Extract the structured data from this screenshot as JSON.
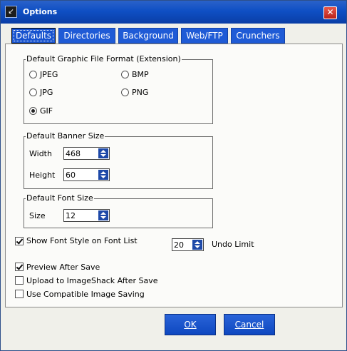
{
  "window": {
    "title": "Options",
    "app_icon_glyph": "↙",
    "close_glyph": "✕"
  },
  "tabs": [
    {
      "label": "Defaults",
      "active": true
    },
    {
      "label": "Directories",
      "active": false
    },
    {
      "label": "Background",
      "active": false
    },
    {
      "label": "Web/FTP",
      "active": false
    },
    {
      "label": "Crunchers",
      "active": false
    }
  ],
  "graphic_format": {
    "title": "Default Graphic File Format (Extension)",
    "options": [
      {
        "label": "JPEG",
        "checked": false
      },
      {
        "label": "BMP",
        "checked": false
      },
      {
        "label": "JPG",
        "checked": false
      },
      {
        "label": "PNG",
        "checked": false
      },
      {
        "label": "GIF",
        "checked": true
      }
    ]
  },
  "banner_size": {
    "title": "Default Banner Size",
    "width_label": "Width",
    "width_value": "468",
    "height_label": "Height",
    "height_value": "60"
  },
  "font_size": {
    "title": "Default Font Size",
    "size_label": "Size",
    "size_value": "12"
  },
  "options": {
    "show_font_style": {
      "label": "Show Font Style on Font List",
      "checked": true
    },
    "undo_limit": {
      "label": "Undo Limit",
      "value": "20"
    },
    "preview_after_save": {
      "label": "Preview After Save",
      "checked": true
    },
    "upload_imageshack": {
      "label": "Upload to ImageShack After Save",
      "checked": false
    },
    "compatible_saving": {
      "label": "Use Compatible Image Saving",
      "checked": false
    }
  },
  "buttons": {
    "ok": "OK",
    "cancel": "Cancel"
  },
  "colors": {
    "titlebar": "#0f4fc4",
    "tab": "#1f5bd6",
    "close": "#c4302b"
  }
}
